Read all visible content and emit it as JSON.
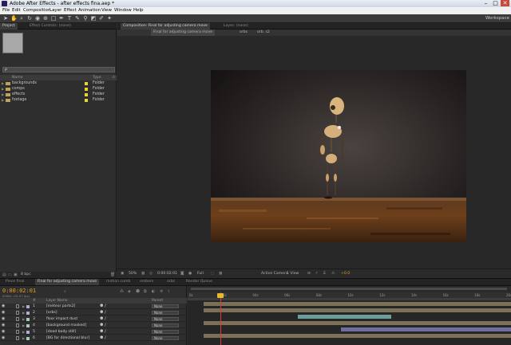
{
  "window": {
    "title": "Adobe After Effects - after effects fina.aep *",
    "minimize": "–",
    "maximize": "□",
    "close": "✕"
  },
  "menu": [
    "File",
    "Edit",
    "Composition",
    "Layer",
    "Effect",
    "Animation",
    "View",
    "Window",
    "Help"
  ],
  "toolbar": {
    "workspace_label": "Workspace"
  },
  "project_panel": {
    "tabs": [
      "Project",
      "Effect Controls: (none)"
    ],
    "search_value": "ρ",
    "columns": [
      "Name",
      "Type"
    ],
    "items": [
      {
        "name": "backgrounds",
        "type": "Folder"
      },
      {
        "name": "comps",
        "type": "Folder"
      },
      {
        "name": "effects",
        "type": "Folder"
      },
      {
        "name": "footage",
        "type": "Folder"
      }
    ],
    "footer": "8 bpc"
  },
  "comp_panel": {
    "tabs": [
      "Composition: Final for adjusting camera move",
      "Layer: (none)"
    ],
    "breadcrumb": [
      "Final for adjusting camera move",
      "orbs",
      "orb. s2"
    ],
    "footer": {
      "zoom": "50%",
      "timecode": "0:00:02:01",
      "resolution": "Full",
      "camera": "Active Camera",
      "view": "1 View",
      "exposure": "+0.0"
    }
  },
  "timeline": {
    "tabs": [
      "Piece final",
      "Final for adjusting camera move",
      "motion comb",
      "embers",
      "orbs",
      "Render Queue"
    ],
    "timecode": "0:00:02:01",
    "timecode_sub": "00061 (29.97 fps)",
    "columns": {
      "num": "#",
      "source": "Layer Name",
      "parent": "Parent"
    },
    "ruler_labels": [
      "0s",
      "02s",
      "04s",
      "06s",
      "08s",
      "10s",
      "12s",
      "14s",
      "16s",
      "18s",
      "20s"
    ],
    "playhead_seconds": 2.03,
    "layers": [
      {
        "num": "1",
        "name": "[meteor parts2]",
        "parent": "None",
        "color": "#b5a7d9"
      },
      {
        "num": "2",
        "name": "[orbs]",
        "parent": "None",
        "color": "#b5a7d9"
      },
      {
        "num": "3",
        "name": "floor impact dust",
        "parent": "None",
        "color": "#a6c8b9"
      },
      {
        "num": "4",
        "name": "[background masked]",
        "parent": "None",
        "color": "#a6c8b9"
      },
      {
        "num": "5",
        "name": "[dead body still]",
        "parent": "None",
        "color": "#b5a7d9"
      },
      {
        "num": "6",
        "name": "[BG for directional blur]",
        "parent": "None",
        "color": "#a6c8b9"
      }
    ],
    "bars": [
      {
        "start": 1.0,
        "end": 20,
        "color": "#7a7258"
      },
      {
        "start": 1.0,
        "end": 20,
        "color": "#7a7258"
      },
      {
        "start": 6.8,
        "end": 12.6,
        "color": "#6e9e9a"
      },
      {
        "start": 1.0,
        "end": 20,
        "color": "#7a7258"
      },
      {
        "start": 9.5,
        "end": 20,
        "color": "#6e6e9e"
      },
      {
        "start": 1.0,
        "end": 20,
        "color": "#7a7258"
      }
    ]
  },
  "colors": {
    "accent": "#e8a020",
    "playhead": "#e03a3a",
    "folder_label": "#e6d632"
  }
}
